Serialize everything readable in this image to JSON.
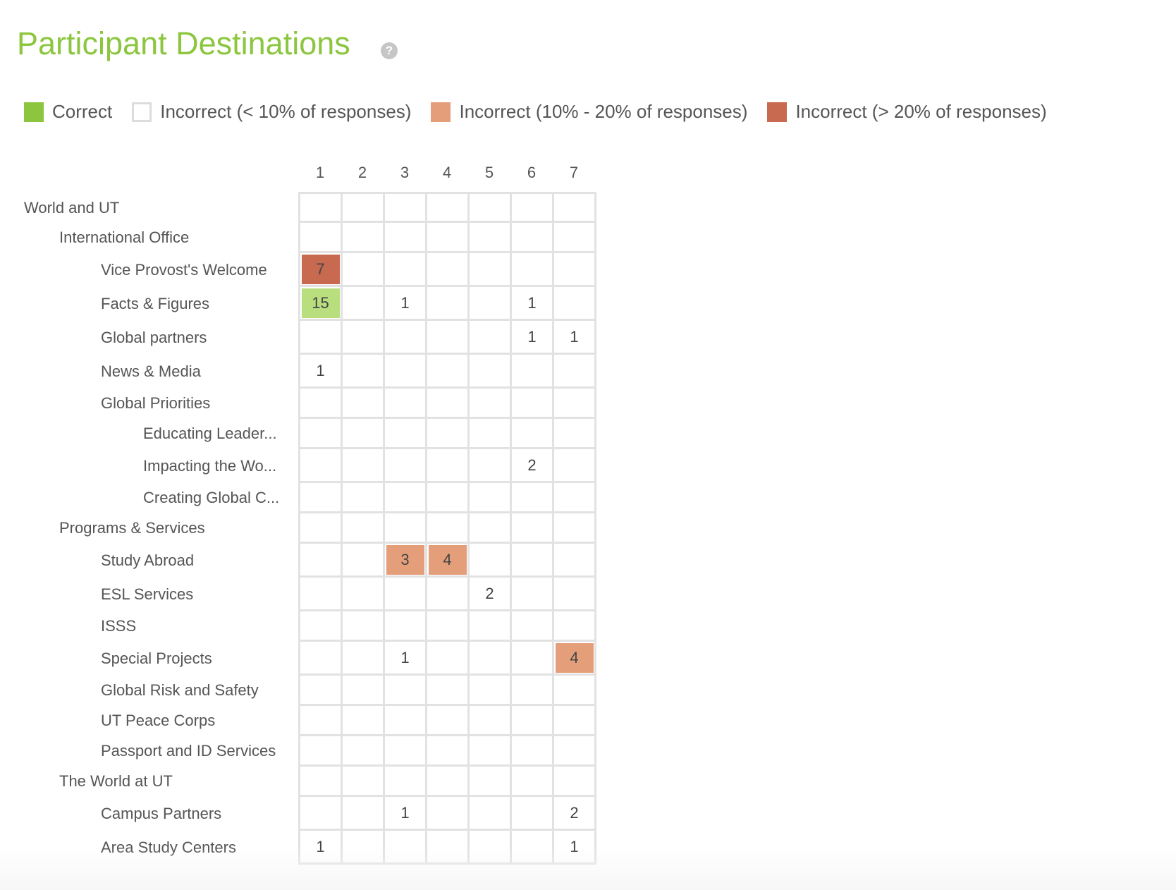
{
  "header": {
    "title": "Participant Destinations",
    "help_icon": "question-circle-icon"
  },
  "colors": {
    "title": "#8cc63f",
    "correct": "#8cc63f",
    "correct_cell": "#b8de7e",
    "incorrect_low": "#ffffff",
    "incorrect_mid": "#e49f7a",
    "incorrect_high": "#c86a4f"
  },
  "legend": [
    {
      "label": "Correct",
      "kind": "correct"
    },
    {
      "label": "Incorrect (< 10% of responses)",
      "kind": "incorrect_low"
    },
    {
      "label": "Incorrect (10% - 20% of responses)",
      "kind": "incorrect_mid"
    },
    {
      "label": "Incorrect (> 20% of responses)",
      "kind": "incorrect_high"
    }
  ],
  "columns": [
    "1",
    "2",
    "3",
    "4",
    "5",
    "6",
    "7"
  ],
  "rows": [
    {
      "label": "World and UT",
      "level": 0,
      "cells": [
        "",
        "",
        "",
        "",
        "",
        "",
        ""
      ]
    },
    {
      "label": "International Office",
      "level": 1,
      "cells": [
        "",
        "",
        "",
        "",
        "",
        "",
        ""
      ]
    },
    {
      "label": "Vice Provost's Welcome",
      "level": 2,
      "cells": [
        {
          "v": "7",
          "k": "incorrect_high"
        },
        "",
        "",
        "",
        "",
        "",
        ""
      ]
    },
    {
      "label": "Facts & Figures",
      "level": 2,
      "cells": [
        {
          "v": "15",
          "k": "correct"
        },
        "",
        "1",
        "",
        "",
        "1",
        ""
      ]
    },
    {
      "label": "Global partners",
      "level": 2,
      "cells": [
        "",
        "",
        "",
        "",
        "",
        "1",
        "1"
      ]
    },
    {
      "label": "News & Media",
      "level": 2,
      "cells": [
        "1",
        "",
        "",
        "",
        "",
        "",
        ""
      ]
    },
    {
      "label": "Global Priorities",
      "level": 2,
      "cells": [
        "",
        "",
        "",
        "",
        "",
        "",
        ""
      ]
    },
    {
      "label": "Educating Leader...",
      "level": 3,
      "cells": [
        "",
        "",
        "",
        "",
        "",
        "",
        ""
      ]
    },
    {
      "label": "Impacting the Wo...",
      "level": 3,
      "cells": [
        "",
        "",
        "",
        "",
        "",
        "2",
        ""
      ]
    },
    {
      "label": "Creating Global C...",
      "level": 3,
      "cells": [
        "",
        "",
        "",
        "",
        "",
        "",
        ""
      ]
    },
    {
      "label": "Programs & Services",
      "level": 1,
      "cells": [
        "",
        "",
        "",
        "",
        "",
        "",
        ""
      ]
    },
    {
      "label": "Study Abroad",
      "level": 2,
      "cells": [
        "",
        "",
        {
          "v": "3",
          "k": "incorrect_mid"
        },
        {
          "v": "4",
          "k": "incorrect_mid"
        },
        "",
        "",
        ""
      ]
    },
    {
      "label": "ESL Services",
      "level": 2,
      "cells": [
        "",
        "",
        "",
        "",
        "2",
        "",
        ""
      ]
    },
    {
      "label": "ISSS",
      "level": 2,
      "cells": [
        "",
        "",
        "",
        "",
        "",
        "",
        ""
      ]
    },
    {
      "label": "Special Projects",
      "level": 2,
      "cells": [
        "",
        "",
        "1",
        "",
        "",
        "",
        {
          "v": "4",
          "k": "incorrect_mid"
        }
      ]
    },
    {
      "label": "Global Risk and Safety",
      "level": 2,
      "cells": [
        "",
        "",
        "",
        "",
        "",
        "",
        ""
      ]
    },
    {
      "label": "UT Peace Corps",
      "level": 2,
      "cells": [
        "",
        "",
        "",
        "",
        "",
        "",
        ""
      ]
    },
    {
      "label": "Passport and ID Services",
      "level": 2,
      "cells": [
        "",
        "",
        "",
        "",
        "",
        "",
        ""
      ]
    },
    {
      "label": "The World at UT",
      "level": 1,
      "cells": [
        "",
        "",
        "",
        "",
        "",
        "",
        ""
      ]
    },
    {
      "label": "Campus Partners",
      "level": 2,
      "cells": [
        "",
        "",
        "1",
        "",
        "",
        "",
        "2"
      ]
    },
    {
      "label": "Area Study Centers",
      "level": 2,
      "cells": [
        "1",
        "",
        "",
        "",
        "",
        "",
        "1"
      ]
    }
  ]
}
